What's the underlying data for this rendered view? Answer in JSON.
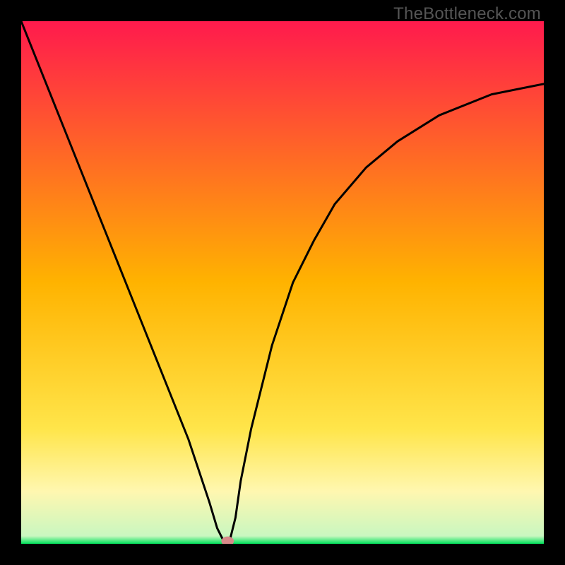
{
  "watermark": "TheBottleneck.com",
  "chart_data": {
    "type": "line",
    "title": "",
    "xlabel": "",
    "ylabel": "",
    "xlim": [
      0,
      100
    ],
    "ylim": [
      0,
      100
    ],
    "grid": false,
    "legend": false,
    "background_gradient": [
      {
        "stop": 0.0,
        "color": "#ff1a4d"
      },
      {
        "stop": 0.5,
        "color": "#ffb300"
      },
      {
        "stop": 0.78,
        "color": "#ffe54a"
      },
      {
        "stop": 0.9,
        "color": "#fff7b0"
      },
      {
        "stop": 0.985,
        "color": "#c9f7c0"
      },
      {
        "stop": 1.0,
        "color": "#00e05a"
      }
    ],
    "series": [
      {
        "name": "bottleneck-curve",
        "color": "#000000",
        "x": [
          0,
          4,
          8,
          12,
          16,
          20,
          24,
          28,
          32,
          34,
          36,
          37.5,
          38.5,
          39.5,
          40,
          41,
          42,
          44,
          48,
          52,
          56,
          60,
          66,
          72,
          80,
          90,
          100
        ],
        "y": [
          100,
          90,
          80,
          70,
          60,
          50,
          40,
          30,
          20,
          14,
          8,
          3,
          1,
          0.5,
          1,
          5,
          12,
          22,
          38,
          50,
          58,
          65,
          72,
          77,
          82,
          86,
          88
        ]
      }
    ],
    "marker": {
      "name": "sweet-spot-marker",
      "x": 39.5,
      "y": 0.5,
      "color": "#d88a8a",
      "rx": 1.2,
      "ry": 0.9
    }
  }
}
